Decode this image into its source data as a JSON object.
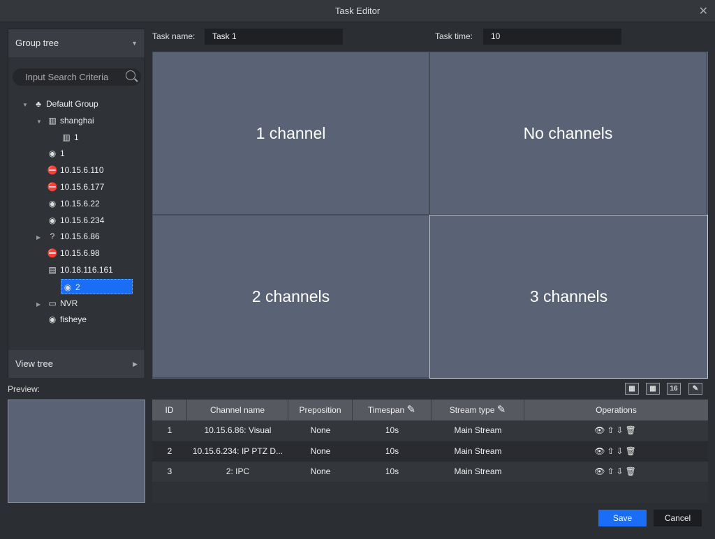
{
  "window": {
    "title": "Task Editor"
  },
  "left": {
    "group_tree": "Group tree",
    "search_placeholder": "Input Search Criteria",
    "view_tree": "View tree",
    "tree": [
      {
        "label": "Default Group",
        "icon": "org-icon",
        "indent": 0,
        "expander": "expanded"
      },
      {
        "label": "shanghai",
        "icon": "map-icon",
        "indent": 1,
        "expander": "expanded"
      },
      {
        "label": "1",
        "icon": "map-icon",
        "indent": 2,
        "expander": ""
      },
      {
        "label": "1",
        "icon": "camera-icon",
        "indent": 1,
        "expander": ""
      },
      {
        "label": "10.15.6.110",
        "icon": "offline-device-icon",
        "indent": 1,
        "expander": ""
      },
      {
        "label": "10.15.6.177",
        "icon": "offline-device-icon",
        "indent": 1,
        "expander": ""
      },
      {
        "label": "10.15.6.22",
        "icon": "camera-icon",
        "indent": 1,
        "expander": ""
      },
      {
        "label": "10.15.6.234",
        "icon": "camera-icon",
        "indent": 1,
        "expander": ""
      },
      {
        "label": "10.15.6.86",
        "icon": "unknown-device-icon",
        "indent": 1,
        "expander": "collapsed"
      },
      {
        "label": "10.15.6.98",
        "icon": "offline-device-icon",
        "indent": 1,
        "expander": ""
      },
      {
        "label": "10.18.116.161",
        "icon": "server-icon",
        "indent": 1,
        "expander": ""
      },
      {
        "label": "2",
        "icon": "camera-icon",
        "indent": 1,
        "expander": "",
        "selected": true
      },
      {
        "label": "NVR",
        "icon": "nvr-icon",
        "indent": 1,
        "expander": "collapsed"
      },
      {
        "label": "fisheye",
        "icon": "camera-icon",
        "indent": 1,
        "expander": ""
      }
    ]
  },
  "preview_label": "Preview:",
  "task": {
    "name_label": "Task name:",
    "name_value": "Task 1",
    "time_label": "Task time:",
    "time_value": "10"
  },
  "cells": [
    "1 channel",
    "No channels",
    "2 channels",
    "3 channels"
  ],
  "selected_cell": 4,
  "toolbar": {
    "layout16": "16"
  },
  "table": {
    "headers": [
      "ID",
      "Channel name",
      "Preposition",
      "Timespan",
      "Stream type",
      "Operations"
    ],
    "rows": [
      [
        "1",
        "10.15.6.86: Visual",
        "None",
        "10s",
        "Main Stream"
      ],
      [
        "2",
        "10.15.6.234: IP PTZ D...",
        "None",
        "10s",
        "Main Stream"
      ],
      [
        "3",
        "2: IPC",
        "None",
        "10s",
        "Main Stream"
      ]
    ]
  },
  "buttons": {
    "save": "Save",
    "cancel": "Cancel"
  },
  "colors": {
    "accent": "#1a6ef5",
    "cell": "#5a6376"
  }
}
